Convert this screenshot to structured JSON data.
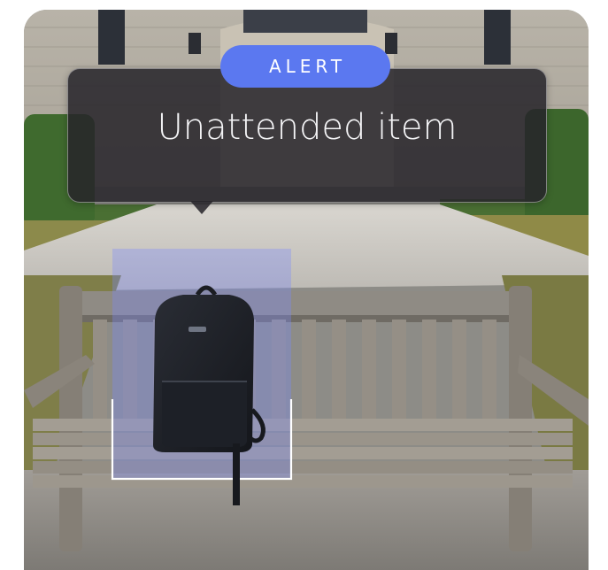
{
  "alert": {
    "badge_label": "ALERT",
    "message": "Unattended item"
  },
  "colors": {
    "badge": "#5b78f0",
    "card": "#26242a",
    "highlight": "#7a88ff"
  },
  "icons": [
    "backpack-icon"
  ]
}
